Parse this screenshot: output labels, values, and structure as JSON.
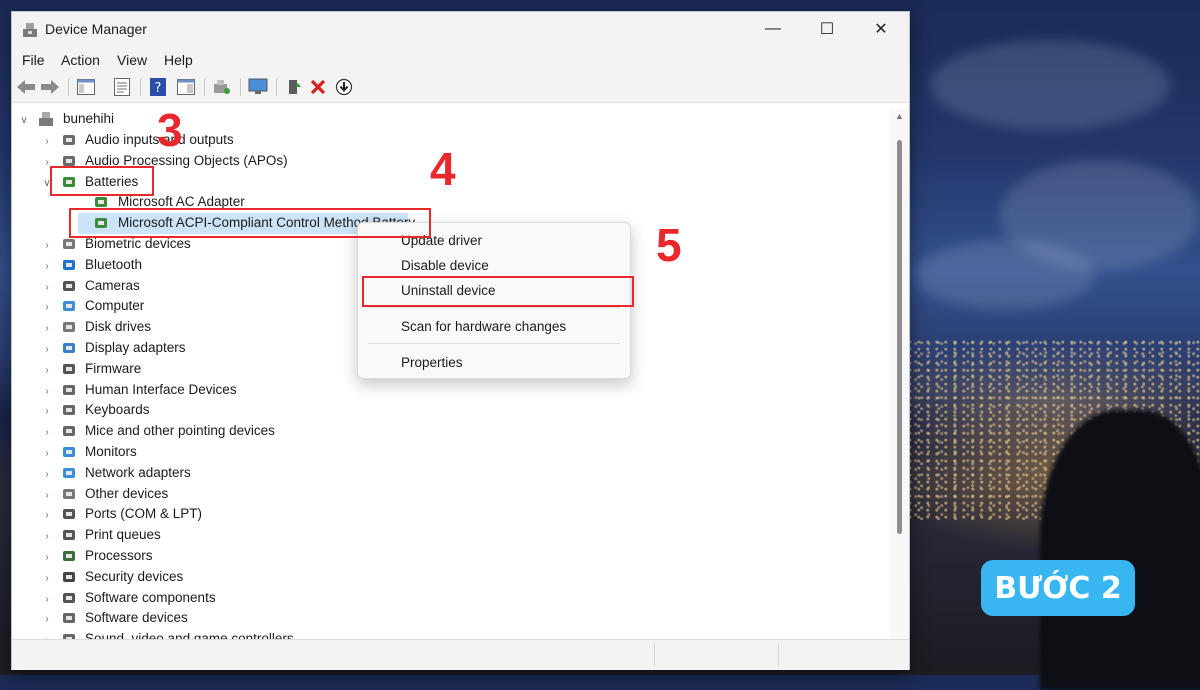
{
  "window": {
    "title": "Device Manager",
    "controls": {
      "minimize": "—",
      "maximize": "☐",
      "close": "✕"
    }
  },
  "menu": [
    "File",
    "Action",
    "View",
    "Help"
  ],
  "toolbar": {
    "icons": [
      "back-icon",
      "forward-icon",
      "show-hide-console-tree-icon",
      "properties-icon",
      "help-icon",
      "action-pane-icon",
      "scan-hardware-icon",
      "monitor-icon",
      "update-driver-icon",
      "uninstall-icon",
      "disable-icon"
    ],
    "uninstall_color": "#d81e1e"
  },
  "tree": {
    "root": "bunehihi",
    "categories": [
      "Audio inputs and outputs",
      "Audio Processing Objects (APOs)",
      "Batteries",
      "Biometric devices",
      "Bluetooth",
      "Cameras",
      "Computer",
      "Disk drives",
      "Display adapters",
      "Firmware",
      "Human Interface Devices",
      "Keyboards",
      "Mice and other pointing devices",
      "Monitors",
      "Network adapters",
      "Other devices",
      "Ports (COM & LPT)",
      "Print queues",
      "Processors",
      "Security devices",
      "Software components",
      "Software devices",
      "Sound, video and game controllers"
    ],
    "battery_children": [
      "Microsoft AC Adapter",
      "Microsoft ACPI-Compliant Control Method Battery"
    ]
  },
  "context_menu": {
    "items": [
      "Update driver",
      "Disable device",
      "Uninstall device",
      "Scan for hardware changes",
      "Properties"
    ]
  },
  "annotations": {
    "step3": "3",
    "step4": "4",
    "step5": "5",
    "highlight_color": "#e8282c"
  },
  "badge": {
    "label": "BƯỚC 2",
    "color": "#38b6f1"
  }
}
